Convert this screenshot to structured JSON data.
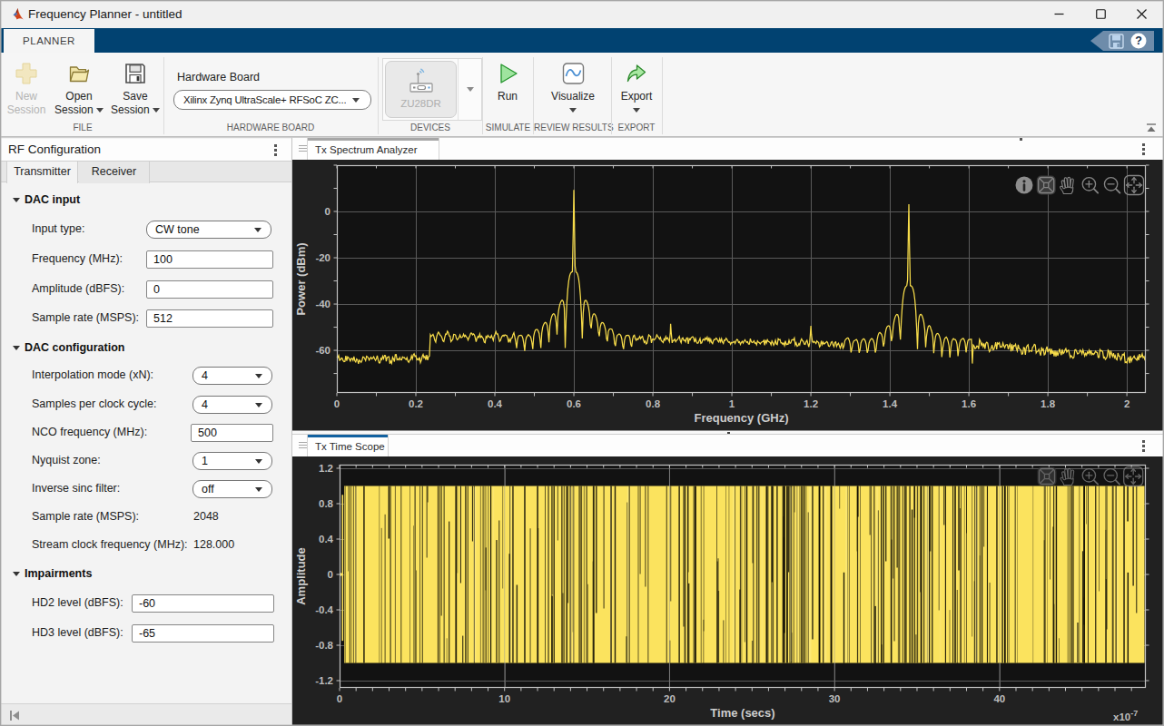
{
  "window": {
    "title": "Frequency Planner - untitled"
  },
  "ribbon": {
    "tab_label": "PLANNER",
    "help_glyph": "?"
  },
  "toolstrip": {
    "file_group": {
      "label": "FILE",
      "new_session_line1": "New",
      "new_session_line2": "Session",
      "open_session_line1": "Open",
      "open_session_line2": "Session",
      "save_session_line1": "Save",
      "save_session_line2": "Session"
    },
    "hardware_group": {
      "label": "HARDWARE BOARD",
      "field_label": "Hardware Board",
      "board_value": "Xilinx Zynq UltraScale+ RFSoC ZC..."
    },
    "devices_group": {
      "label": "DEVICES",
      "device_name": "ZU28DR"
    },
    "simulate_group": {
      "label": "SIMULATE",
      "run_label": "Run"
    },
    "review_group": {
      "label": "REVIEW RESULTS",
      "visualize_label": "Visualize"
    },
    "export_group": {
      "label": "EXPORT",
      "export_label": "Export"
    }
  },
  "panel": {
    "title": "RF Configuration",
    "tabs": [
      {
        "label": "Transmitter",
        "selected": true
      },
      {
        "label": "Receiver",
        "selected": false
      }
    ],
    "sections": [
      {
        "title": "DAC input",
        "rows": [
          {
            "label": "Input type:",
            "control": "dropdown",
            "value": "CW tone",
            "x": 161,
            "w": 138
          },
          {
            "label": "Frequency (MHz):",
            "control": "edit",
            "value": "100",
            "x": 161,
            "w": 140
          },
          {
            "label": "Amplitude (dBFS):",
            "control": "edit",
            "value": "0",
            "x": 161,
            "w": 140
          },
          {
            "label": "Sample rate (MSPS):",
            "control": "edit",
            "value": "512",
            "x": 161,
            "w": 140
          }
        ]
      },
      {
        "title": "DAC configuration",
        "rows": [
          {
            "label": "Interpolation mode (xN):",
            "control": "dropdown",
            "value": "4",
            "x": 212,
            "w": 88
          },
          {
            "label": "Samples per clock cycle:",
            "control": "dropdown",
            "value": "4",
            "x": 212,
            "w": 88
          },
          {
            "label": "NCO frequency (MHz):",
            "control": "edit",
            "value": "500",
            "x": 210,
            "w": 91
          },
          {
            "label": "Nyquist zone:",
            "control": "dropdown",
            "value": "1",
            "x": 212,
            "w": 88
          },
          {
            "label": "Inverse sinc filter:",
            "control": "dropdown",
            "value": "off",
            "x": 212,
            "w": 88
          },
          {
            "label": "Sample rate (MSPS):",
            "control": "readonly",
            "value": "2048",
            "x": 213,
            "w": 88
          },
          {
            "label": "Stream clock frequency (MHz):",
            "control": "readonly",
            "value": "128.000",
            "x": 213,
            "w": 88
          }
        ]
      },
      {
        "title": "Impairments",
        "rows": [
          {
            "label": "HD2 level (dBFS):",
            "control": "edit",
            "value": "-60",
            "x": 145,
            "w": 157
          },
          {
            "label": "HD3 level (dBFS):",
            "control": "edit",
            "value": "-65",
            "x": 145,
            "w": 157
          }
        ]
      }
    ]
  },
  "documents": [
    {
      "tab": "Tx Spectrum Analyzer",
      "focused": false
    },
    {
      "tab": "Tx Time Scope",
      "focused": true
    }
  ],
  "colors": {
    "ribbon_blue": "#014271",
    "tab_focus_blue": "#1261a0",
    "tab_unfocus_gray": "#a6a6a6",
    "figure_bg": "#212121",
    "axes_bg": "#121212",
    "grid": "#5a5a5a",
    "axes_border": "#c2c2c2",
    "tick_text": "#bdbdbd",
    "trace_yellow": "#f7dc4a",
    "scope_yellow": "#fbe35e"
  },
  "chart_data": [
    {
      "type": "line",
      "title": "Tx Spectrum Analyzer",
      "xlabel": "Frequency (GHz)",
      "ylabel": "Power (dBm)",
      "xlim": [
        0,
        2.048
      ],
      "ylim": [
        -78.4,
        20
      ],
      "xticks": [
        0,
        0.2,
        0.4,
        0.6,
        0.8,
        1,
        1.2,
        1.4,
        1.6,
        1.8,
        2
      ],
      "xtick_labels": [
        "0",
        "0.2",
        "0.4",
        "0.6",
        "0.8",
        "1",
        "1.2",
        "1.4",
        "1.6",
        "1.8",
        "2"
      ],
      "yticks": [
        0,
        -20,
        -40,
        -60
      ],
      "grid": true,
      "legend": "none",
      "peaks": [
        {
          "freq_ghz": 0.6,
          "power_dbm": 9.3,
          "lobe_top_dbm": -26,
          "null_dbm": -62
        },
        {
          "freq_ghz": 1.448,
          "power_dbm": 3.2,
          "lobe_top_dbm": -32,
          "null_dbm": -62
        }
      ],
      "spurs": [
        {
          "freq_ghz": 0.845,
          "power_dbm": -50.5
        },
        {
          "freq_ghz": 1.2,
          "power_dbm": -50
        }
      ],
      "sidelobe_null_spacing_ghz": 0.0205,
      "main_lobe_half_width_ghz": 0.0225,
      "noise_floor_dbm": [
        {
          "from_ghz": 0,
          "to_ghz": 0.235,
          "level": -63.8
        },
        {
          "from_ghz": 0.75,
          "to_ghz": 1.28,
          "level_start": -54.8,
          "level_end": -57.6
        },
        {
          "from_ghz": 1.62,
          "to_ghz": 2.048,
          "level_start": -57.8,
          "level_end": -63.6
        }
      ],
      "seed": 42
    },
    {
      "type": "line",
      "title": "Tx Time Scope",
      "xlabel": "Time (secs)",
      "ylabel": "Amplitude",
      "x_exponent_mantissa": "x10",
      "x_exponent_power": "-7",
      "xlim": [
        0,
        48.87
      ],
      "ylim": [
        -1.282,
        1.241
      ],
      "xticks": [
        0,
        10,
        20,
        30,
        40
      ],
      "xtick_labels": [
        "0",
        "10",
        "20",
        "30",
        "40"
      ],
      "yticks": [
        -1.2,
        -0.8,
        -0.4,
        0,
        0.4,
        0.8,
        1.2
      ],
      "ytick_labels": [
        "-1.2",
        "-0.8",
        "-0.4",
        "0",
        "0.4",
        "0.8",
        "1.2"
      ],
      "grid": true,
      "signal": {
        "kind": "cw-tone",
        "amplitude": 1.0,
        "frequency_hz": 100000000,
        "appearance": "dense-fill"
      },
      "seed": 7
    }
  ]
}
